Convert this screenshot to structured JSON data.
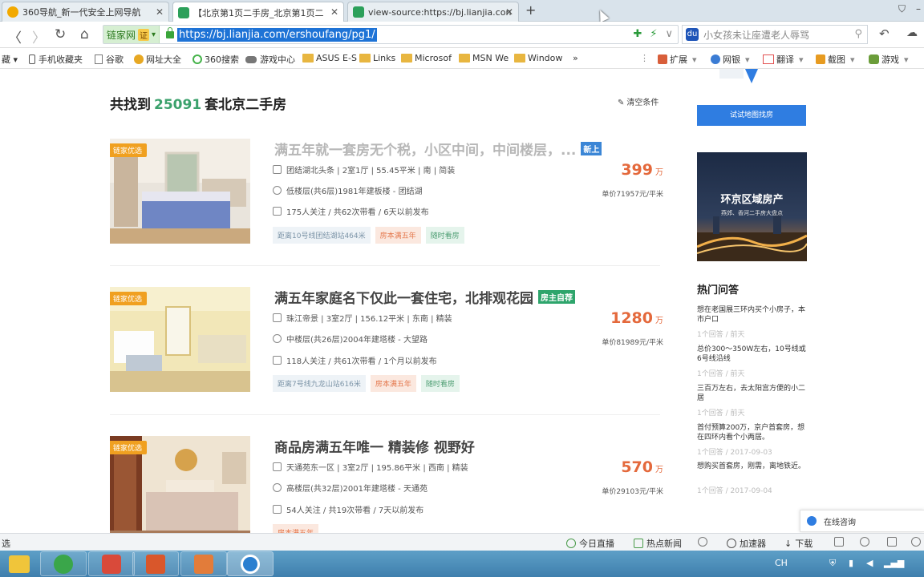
{
  "tabs": [
    {
      "title": "360导航_新一代安全上网导航",
      "icon_color": "#f2a900"
    },
    {
      "title": "【北京第1页二手房_北京第1页二",
      "icon_color": "#2ca05a"
    },
    {
      "title": "view-source:https://bj.lianjia.con",
      "icon_color": "#2ca05a"
    }
  ],
  "tab_close_glyph": "✕",
  "new_tab_glyph": "+",
  "window_controls": [
    "⛉",
    "–"
  ],
  "nav": {
    "back": "〈",
    "forward": "〉",
    "reload": "↻",
    "home": "⌂"
  },
  "address": {
    "cert_name": "链家网",
    "cert_badge": "证",
    "cert_arrow": "▾",
    "url": "https://bj.lianjia.com/ershoufang/pg1/",
    "right_icons": [
      "✚",
      "⚡",
      "∨"
    ]
  },
  "search": {
    "paw": "🐾",
    "placeholder": "小女孩未让座遭老人辱骂",
    "icon": "⚲",
    "extra": [
      "↶",
      "☁"
    ]
  },
  "bookmarks": [
    {
      "label": "藏 ▾",
      "type": "text"
    },
    {
      "label": "手机收藏夹",
      "type": "phone"
    },
    {
      "label": "谷歌",
      "type": "page"
    },
    {
      "label": "网址大全",
      "type": "dot",
      "color": "#e7a823"
    },
    {
      "label": "360搜索",
      "type": "dot",
      "color": "#46b34a"
    },
    {
      "label": "游戏中心",
      "type": "game"
    },
    {
      "label": "ASUS E-S",
      "type": "folder"
    },
    {
      "label": "Links",
      "type": "folder"
    },
    {
      "label": "Microsof",
      "type": "folder"
    },
    {
      "label": "MSN We",
      "type": "folder"
    },
    {
      "label": "Window",
      "type": "folder"
    },
    {
      "label": "»",
      "type": "text"
    }
  ],
  "toolbar_right": [
    {
      "label": "扩展",
      "color": "#d85e3a"
    },
    {
      "label": "网银",
      "color": "#3b7cd4"
    },
    {
      "label": "翻译",
      "color": "#e25050"
    },
    {
      "label": "截图",
      "color": "#e79b21"
    },
    {
      "label": "游戏",
      "color": "#6b9d3a"
    }
  ],
  "results": {
    "prefix": "共找到",
    "count": "25091",
    "suffix": "套北京二手房",
    "clear": "清空条件"
  },
  "listings": [
    {
      "tag": "链家优选",
      "title": "满五年就一套房无个税，小区中间，中间楼层，...",
      "badge": "新上",
      "badge_color": "#3b86d6",
      "dim": true,
      "info": "团结湖北头条 | 2室1厅 | 55.45平米 | 南 | 简装",
      "floor": "低楼层(共6层)1981年建板楼 - 团结湖",
      "follow": "175人关注 / 共62次带看 / 6天以前发布",
      "chips": [
        {
          "text": "距离10号线团结湖站464米",
          "style": "blue"
        },
        {
          "text": "房本满五年",
          "style": "orange"
        },
        {
          "text": "随时看房",
          "style": "green"
        }
      ],
      "price": "399",
      "price_unit": "万",
      "unit_price": "单价71957元/平米",
      "photo": "bedroom-blue"
    },
    {
      "tag": "链家优选",
      "title": "满五年家庭名下仅此一套住宅，北排观花园",
      "badge": "房主自荐",
      "badge_color": "#2ea56c",
      "dim": false,
      "info": "珠江帝景 | 3室2厅 | 156.12平米 | 东南 | 精装",
      "floor": "中楼层(共26层)2004年建塔楼 - 大望路",
      "follow": "118人关注 / 共61次带看 / 1个月以前发布",
      "chips": [
        {
          "text": "距离7号线九龙山站616米",
          "style": "blue"
        },
        {
          "text": "房本满五年",
          "style": "orange"
        },
        {
          "text": "随时看房",
          "style": "green"
        }
      ],
      "price": "1280",
      "price_unit": "万",
      "unit_price": "单价81989元/平米",
      "photo": "living-yellow"
    },
    {
      "tag": "链家优选",
      "title": "商品房满五年唯一 精装修 视野好",
      "badge": "",
      "badge_color": "",
      "dim": false,
      "info": "天通苑东一区 | 3室2厅 | 195.86平米 | 西南 | 精装",
      "floor": "高楼层(共32层)2001年建塔楼 - 天通苑",
      "follow": "54人关注 / 共19次带看 / 7天以前发布",
      "chips": [
        {
          "text": "房本满五年",
          "style": "orange"
        }
      ],
      "price": "570",
      "price_unit": "万",
      "unit_price": "单价29103元/平米",
      "photo": "bedroom-red"
    }
  ],
  "sidebar": {
    "map_button": "试试地图找房",
    "banner_title": "环京区域房产",
    "banner_sub": "燕郊、香河二手房大盘点",
    "qa_title": "热门问答",
    "questions": [
      {
        "q": "想在老国展三环内买个小房子，本市户口",
        "meta": "1个回答 / 前天"
      },
      {
        "q": "总价300～350W左右，10号线或6号线沿线",
        "meta": "1个回答 / 前天"
      },
      {
        "q": "三百万左右，去太阳宫方便的小二居",
        "meta": "1个回答 / 前天"
      },
      {
        "q": "首付预算200万，京户首套房，想在四环内看个小两居。",
        "meta": "1个回答 / 2017-09-03"
      },
      {
        "q": "想购买首套房，刚需，离地铁近。",
        "meta": "1个回答 / 2017-09-04"
      }
    ],
    "chat": "在线咨询"
  },
  "statusbar": {
    "left": "选",
    "items": [
      "今日直播",
      "热点新闻",
      "",
      "加速器",
      "下载",
      "",
      ""
    ]
  },
  "tray": {
    "lang": "CH"
  }
}
